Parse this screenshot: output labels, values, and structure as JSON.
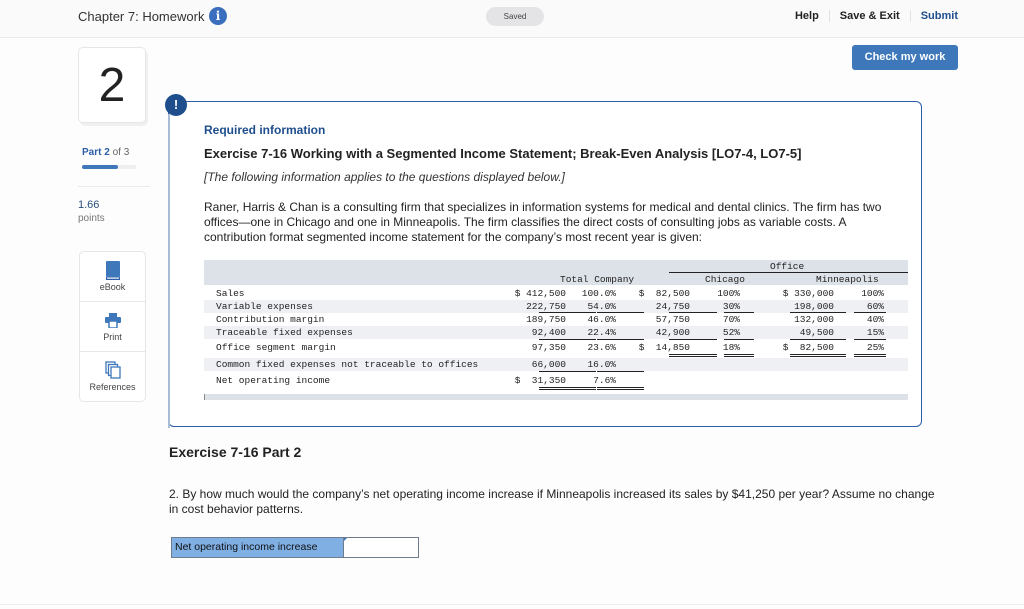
{
  "header": {
    "chapter_title": "Chapter 7: Homework",
    "info_icon": "info-icon",
    "saved_status": "Saved",
    "help": "Help",
    "save_exit": "Save & Exit",
    "submit": "Submit",
    "check_work": "Check my work"
  },
  "sidebar": {
    "question_number": "2",
    "part_word": "Part",
    "part_current": "2",
    "part_of": "of 3",
    "part_progress_fraction": 0.667,
    "points_value": "1.66",
    "points_label": "points",
    "tools": [
      {
        "label": "eBook",
        "icon": "book-icon"
      },
      {
        "label": "Print",
        "icon": "printer-icon"
      },
      {
        "label": "References",
        "icon": "copy-icon"
      }
    ]
  },
  "required_info": {
    "alert_icon": "!",
    "heading": "Required information",
    "exercise_title": "Exercise 7-16 Working with a Segmented Income Statement; Break-Even Analysis [LO7-4, LO7-5]",
    "note": "[The following information applies to the questions displayed below.]",
    "description": "Raner, Harris & Chan is a consulting firm that specializes in information systems for medical and dental clinics. The firm has two offices—one in Chicago and one in Minneapolis. The firm classifies the direct costs of consulting jobs as variable costs. A contribution format segmented income statement for the company’s most recent year is given:"
  },
  "statement": {
    "group_header": "Office",
    "col_headers": {
      "total": "Total Company",
      "chicago": "Chicago",
      "minneapolis": "Minneapolis"
    },
    "rows": [
      {
        "label": "Sales",
        "total": "$ 412,500",
        "total_pct": "100.0%",
        "chi": "$  82,500",
        "chi_pct": "100%",
        "min": "$ 330,000",
        "min_pct": "100%"
      },
      {
        "label": "Variable expenses",
        "total": "222,750",
        "total_pct": "54.0%",
        "chi": "24,750",
        "chi_pct": "30%",
        "min": "198,000",
        "min_pct": "60%"
      },
      {
        "label": "Contribution margin",
        "total": "189,750",
        "total_pct": "46.0%",
        "chi": "57,750",
        "chi_pct": "70%",
        "min": "132,000",
        "min_pct": "40%"
      },
      {
        "label": "Traceable fixed expenses",
        "total": "92,400",
        "total_pct": "22.4%",
        "chi": "42,900",
        "chi_pct": "52%",
        "min": "49,500",
        "min_pct": "15%"
      },
      {
        "label": "Office segment margin",
        "total": "97,350",
        "total_pct": "23.6%",
        "chi": "$  14,850",
        "chi_pct": "18%",
        "min": "$  82,500",
        "min_pct": "25%"
      },
      {
        "label": "Common fixed expenses not traceable to offices",
        "total": "66,000",
        "total_pct": "16.0%",
        "chi": "",
        "chi_pct": "",
        "min": "",
        "min_pct": ""
      },
      {
        "label": "Net operating income",
        "total": "$  31,350",
        "total_pct": "7.6%",
        "chi": "",
        "chi_pct": "",
        "min": "",
        "min_pct": ""
      }
    ]
  },
  "part": {
    "heading": "Exercise 7-16 Part 2",
    "question": "2. By how much would the company’s net operating income increase if Minneapolis increased its sales by $41,250 per year? Assume no change in cost behavior patterns.",
    "answer_label": "Net operating income increase",
    "answer_value": ""
  }
}
